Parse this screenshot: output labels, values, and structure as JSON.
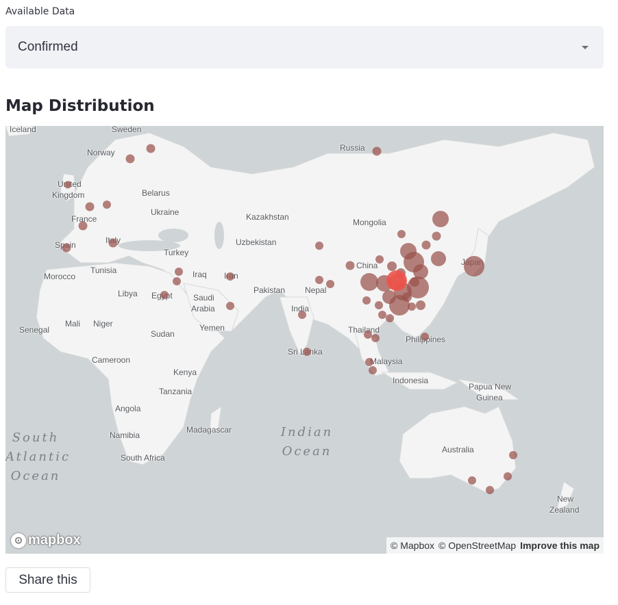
{
  "select": {
    "label": "Available Data",
    "value": "Confirmed"
  },
  "map_section": {
    "title": "Map Distribution"
  },
  "map": {
    "countries": [
      "Iceland",
      "Sweden",
      "Norway",
      "Russia",
      "United",
      "Kingdom",
      "Belarus",
      "Ukraine",
      "France",
      "Kazakhstan",
      "Mongolia",
      "Spain",
      "Italy",
      "Uzbekistan",
      "Turkey",
      "Morocco",
      "Tunisia",
      "Iraq",
      "Iran",
      "China",
      "Japan",
      "Libya",
      "Egypt",
      "Saudi",
      "Arabia",
      "Pakistan",
      "Nepal",
      "India",
      "Mali",
      "Niger",
      "Yemen",
      "Senegal",
      "Sudan",
      "Thailand",
      "Philippines",
      "Sri Lanka",
      "Cameroon",
      "Kenya",
      "Malaysia",
      "Indonesia",
      "Tanzania",
      "Papua New",
      "Guinea",
      "Angola",
      "Madagascar",
      "Namibia",
      "South Africa",
      "Australia",
      "New",
      "Zealand"
    ],
    "oceans": [
      "South\nAtlantic\nOcean",
      "Indian\nOcean"
    ],
    "attribution": {
      "mapbox": "© Mapbox",
      "osm": "© OpenStreetMap",
      "improve": "Improve this map"
    },
    "logo_text": "mapbox",
    "bubble_color": "#9a524c",
    "highlight_color": "#f0534a",
    "land_color": "#f4f4f4",
    "water_color": "#cfd4d6"
  },
  "share_button": "Share this"
}
